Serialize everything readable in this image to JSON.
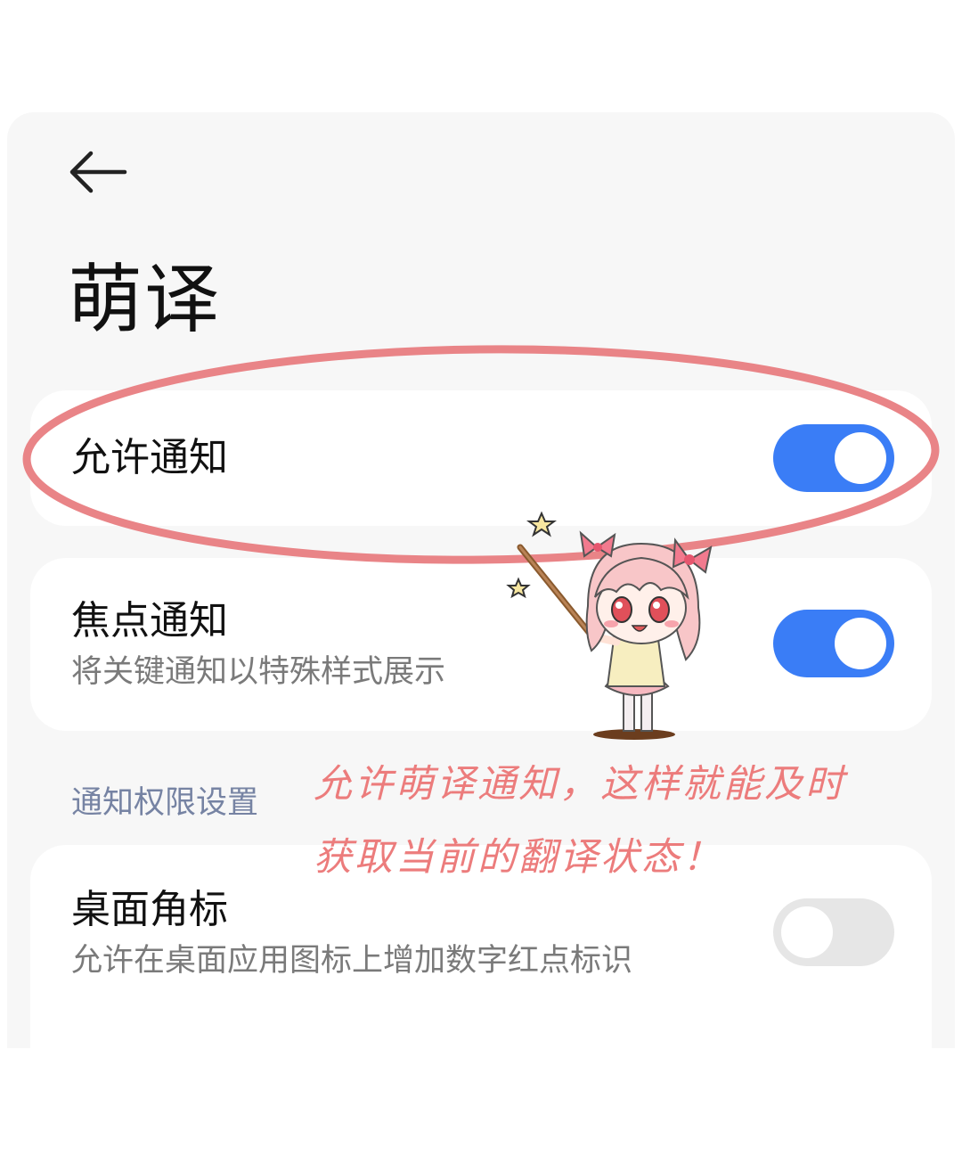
{
  "header": {
    "back_icon": "arrow-left-icon",
    "title": "萌译"
  },
  "settings": {
    "allow_notifications": {
      "title": "允许通知",
      "enabled": true
    },
    "focus_notifications": {
      "title": "焦点通知",
      "subtitle": "将关键通知以特殊样式展示",
      "enabled": true
    },
    "section_header": "通知权限设置",
    "desktop_badge": {
      "title": "桌面角标",
      "subtitle": "允许在桌面应用图标上增加数字红点标识",
      "enabled": false
    }
  },
  "annotation": {
    "line1": "允许萌译通知，这样就能及时",
    "line2": "获取当前的翻译状态！",
    "color": "#ec7c7c"
  },
  "colors": {
    "toggle_on": "#3a7df6",
    "toggle_off": "#e6e6e6",
    "section_header": "#7683a3"
  }
}
